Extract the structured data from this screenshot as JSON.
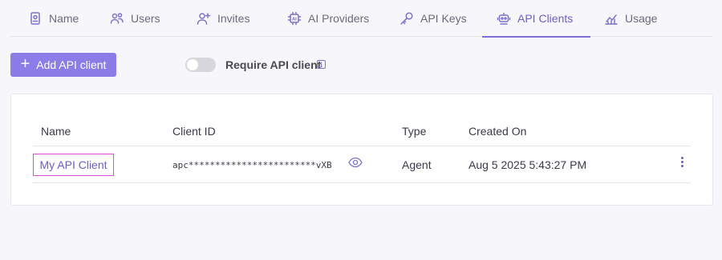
{
  "tabs": [
    {
      "label": "Name",
      "icon": "id-badge-icon"
    },
    {
      "label": "Users",
      "icon": "users-icon"
    },
    {
      "label": "Invites",
      "icon": "add-user-icon"
    },
    {
      "label": "AI Providers",
      "icon": "ai-chip-icon"
    },
    {
      "label": "API Keys",
      "icon": "key-icon"
    },
    {
      "label": "API Clients",
      "icon": "robot-icon",
      "active": true
    },
    {
      "label": "Usage",
      "icon": "chart-icon"
    }
  ],
  "toolbar": {
    "add_label": "Add API client",
    "require_label": "Require API client",
    "require_enabled": false
  },
  "table": {
    "headers": [
      "Name",
      "Client ID",
      "Type",
      "Created On"
    ],
    "rows": [
      {
        "name": "My API Client",
        "client_id": "apc************************vXB",
        "type": "Agent",
        "created_on": "Aug 5 2025 5:43:27 PM"
      }
    ]
  },
  "colors": {
    "accent": "#8b7de8",
    "accent_text": "#6a5fc7",
    "highlight": "#e14ad5"
  }
}
